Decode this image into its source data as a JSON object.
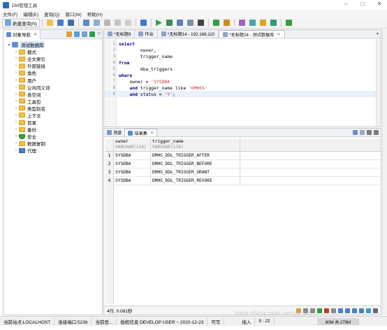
{
  "window": {
    "title": "DM管理工具"
  },
  "menu": [
    "文件(F)",
    "编辑(E)",
    "查询(Q)",
    "窗口(W)",
    "帮助(H)"
  ],
  "toolbar": {
    "new_query_label": "新建查询(N)"
  },
  "left_panel": {
    "tab_label": "对象导航",
    "tree": [
      {
        "label": "测试数据库",
        "level": 0,
        "expanded": true,
        "selected": true,
        "icon": "database-icon"
      },
      {
        "label": "模式",
        "level": 1,
        "icon": "folder-icon"
      },
      {
        "label": "全文索引",
        "level": 1,
        "icon": "folder-icon"
      },
      {
        "label": "外部链接",
        "level": 1,
        "icon": "folder-icon"
      },
      {
        "label": "角色",
        "level": 1,
        "icon": "folder-icon"
      },
      {
        "label": "用户",
        "level": 1,
        "icon": "folder-icon"
      },
      {
        "label": "公共同义词",
        "level": 1,
        "icon": "folder-icon"
      },
      {
        "label": "表空间",
        "level": 1,
        "icon": "folder-icon"
      },
      {
        "label": "工具包",
        "level": 1,
        "icon": "folder-icon"
      },
      {
        "label": "类型别名",
        "level": 1,
        "icon": "folder-icon"
      },
      {
        "label": "上下文",
        "level": 1,
        "icon": "folder-icon"
      },
      {
        "label": "目录",
        "level": 1,
        "icon": "folder-icon"
      },
      {
        "label": "备份",
        "level": 1,
        "icon": "folder-icon"
      },
      {
        "label": "安全",
        "level": 1,
        "icon": "shield-icon"
      },
      {
        "label": "数据复制",
        "level": 1,
        "icon": "folder-icon"
      },
      {
        "label": "代理",
        "level": 1,
        "icon": "stack-icon"
      }
    ]
  },
  "editor": {
    "tabs": [
      {
        "label": "*无标题9",
        "active": false
      },
      {
        "label": "作业",
        "active": false
      },
      {
        "label": "*无标题14 - 192.168.110",
        "active": false
      },
      {
        "label": "*无标题24 - 测试数据库",
        "active": true
      }
    ],
    "lines": [
      {
        "n": "1",
        "parts": [
          {
            "t": "select",
            "c": "kw"
          }
        ]
      },
      {
        "n": "2",
        "parts": [
          {
            "t": "        owner,",
            "c": ""
          }
        ]
      },
      {
        "n": "3",
        "parts": [
          {
            "t": "        trigger_name",
            "c": ""
          }
        ]
      },
      {
        "n": "4",
        "parts": [
          {
            "t": "from",
            "c": "kw"
          }
        ]
      },
      {
        "n": "5",
        "parts": [
          {
            "t": "        dba_triggers",
            "c": ""
          }
        ]
      },
      {
        "n": "6",
        "parts": [
          {
            "t": "where",
            "c": "kw"
          }
        ]
      },
      {
        "n": "7",
        "parts": [
          {
            "t": "    owner = ",
            "c": ""
          },
          {
            "t": "'SYSDBA'",
            "c": "str"
          }
        ]
      },
      {
        "n": "8",
        "parts": [
          {
            "t": "    ",
            "c": ""
          },
          {
            "t": "and",
            "c": "kw"
          },
          {
            "t": " trigger_name like ",
            "c": ""
          },
          {
            "t": "'DMHS%'",
            "c": "str"
          }
        ]
      },
      {
        "n": "9",
        "parts": [
          {
            "t": "    ",
            "c": ""
          },
          {
            "t": "and",
            "c": "kw"
          },
          {
            "t": " status = ",
            "c": ""
          },
          {
            "t": "'Y'",
            "c": "str"
          },
          {
            "t": ";",
            "c": ""
          }
        ],
        "highlight": true
      }
    ]
  },
  "result": {
    "tabs": [
      {
        "label": "消息",
        "active": false
      },
      {
        "label": "结果集",
        "active": true
      }
    ],
    "columns": [
      {
        "name": "owner",
        "type": "VARCHAR(128)"
      },
      {
        "name": "trigger_name",
        "type": "VARCHAR(128)"
      }
    ],
    "rows": [
      {
        "idx": "1",
        "cells": [
          "SYSDBA",
          "DMHS_DDL_TRIGGER_AFTER"
        ]
      },
      {
        "idx": "2",
        "cells": [
          "SYSDBA",
          "DMHS_DDL_TRIGGER_BEFORE"
        ]
      },
      {
        "idx": "3",
        "cells": [
          "SYSDBA",
          "DMHS_DDL_TRIGGER_GRANT"
        ]
      },
      {
        "idx": "4",
        "cells": [
          "SYSDBA",
          "DMHS_DDL_TRIGGER_REVOKE"
        ]
      }
    ],
    "status": "4行, 0.081秒"
  },
  "statusbar": {
    "site": "当前站点:LOCALHOST",
    "port": "连接端口:5236",
    "current": "当前登...",
    "license": "授权信息:DEVELOP USER ~ 2020-12-23",
    "writable": "可写",
    "insert": "插入",
    "position": "9 : 22",
    "memory": "80M 共 279M"
  },
  "watermark": "https://blog.csdn.net/qq_40..."
}
